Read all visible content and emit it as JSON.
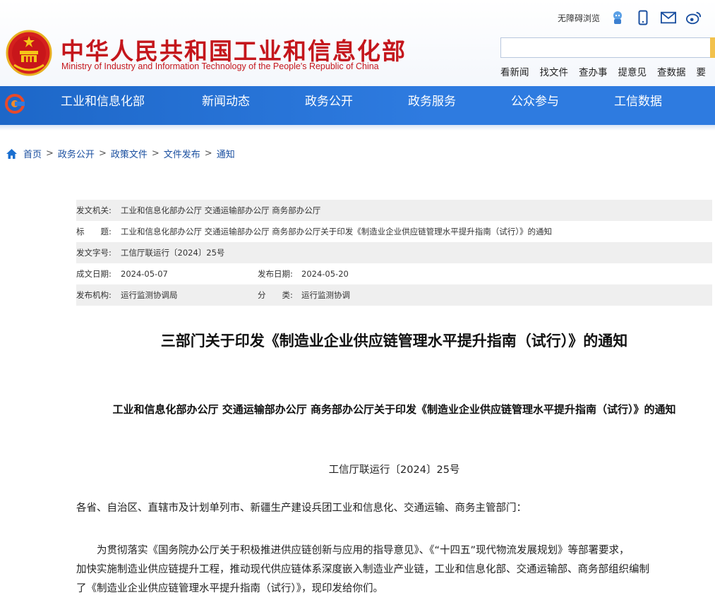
{
  "header": {
    "title": "中华人民共和国工业和信息化部",
    "subtitle": "Ministry of Industry and Information Technology of the People's Republic of China",
    "accessibility_link": "无障碍浏览",
    "icons": [
      "robot-icon",
      "mobile-icon",
      "mail-icon",
      "weibo-icon"
    ],
    "quick_links": [
      "看新闻",
      "找文件",
      "查办事",
      "提意见",
      "查数据",
      "要"
    ]
  },
  "nav": {
    "items": [
      "工业和信息化部",
      "新闻动态",
      "政务公开",
      "政务服务",
      "公众参与",
      "工信数据"
    ]
  },
  "breadcrumb": [
    "首页",
    "政务公开",
    "政策文件",
    "文件发布",
    "通知"
  ],
  "info": {
    "issuer_label": "发文机关:",
    "issuer": "工业和信息化部办公厅 交通运输部办公厅 商务部办公厅",
    "title_label": "标　　题:",
    "title": "工业和信息化部办公厅 交通运输部办公厅 商务部办公厅关于印发《制造业企业供应链管理水平提升指南（试行）》的通知",
    "docno_label": "发文字号:",
    "docno": "工信厅联运行〔2024〕25号",
    "created_label": "成文日期:",
    "created": "2024-05-07",
    "published_label": "发布日期:",
    "published": "2024-05-20",
    "org_label": "发布机构:",
    "org": "运行监测协调局",
    "category_label": "分　　类:",
    "category": "运行监测协调"
  },
  "article": {
    "title": "三部门关于印发《制造业企业供应链管理水平提升指南（试行）》的通知",
    "subtitle": "工业和信息化部办公厅 交通运输部办公厅 商务部办公厅关于印发《制造业企业供应链管理水平提升指南（试行）》的通知",
    "doc_number": "工信厅联运行〔2024〕25号",
    "addressee": "各省、自治区、直辖市及计划单列市、新疆生产建设兵团工业和信息化、交通运输、商务主管部门：",
    "body_lines": [
      "　　为贯彻落实《国务院办公厅关于积极推进供应链创新与应用的指导意见》、《“十四五”现代物流发展规划》等部署要求，",
      "加快实施制造业供应链提升工程，推动现代供应链体系深度嵌入制造业产业链，工业和信息化部、交通运输部、商务部组织编制",
      "了《制造业企业供应链管理水平提升指南（试行）》，现印发给你们。"
    ]
  },
  "colors": {
    "brand_red": "#c4161c",
    "nav_blue": "#2e7be0",
    "link_blue": "#1a4fa0"
  }
}
